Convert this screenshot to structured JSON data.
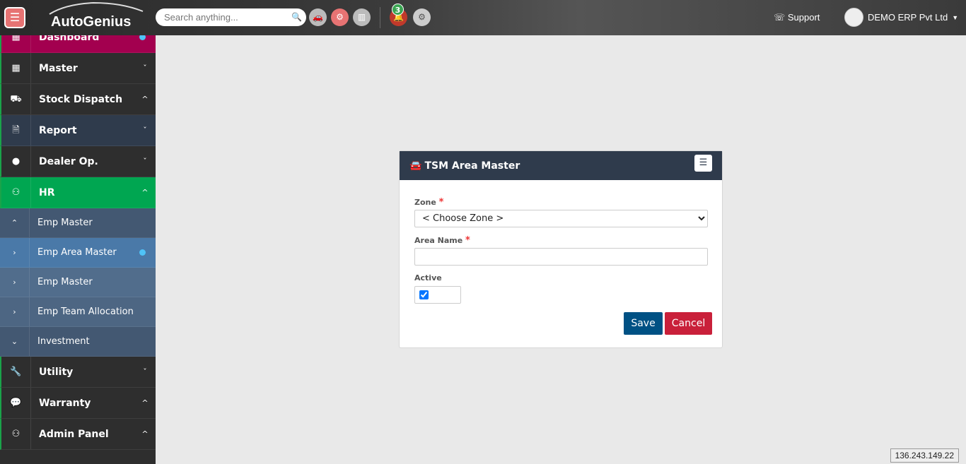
{
  "header": {
    "logo": "AutoGenius",
    "search_placeholder": "Search anything...",
    "notification_count": "3",
    "support": "Support",
    "user": "DEMO ERP Pvt Ltd"
  },
  "sidebar": {
    "items": [
      {
        "label": "Dashboard",
        "icon": "dashboard-icon",
        "bg": "#a3004f",
        "dot": true
      },
      {
        "label": "Master",
        "icon": "grid-icon",
        "chevron": "down"
      },
      {
        "label": "Stock Dispatch",
        "icon": "truck-icon",
        "chevron": "up"
      },
      {
        "label": "Report",
        "icon": "excel-file-icon",
        "bg": "#2f3b4c",
        "chevron": "down"
      },
      {
        "label": "Dealer Op.",
        "icon": "user-icon",
        "chevron": "down"
      },
      {
        "label": "HR",
        "icon": "users-icon",
        "bg": "#00a651",
        "chevron": "up"
      },
      {
        "label": "Emp Master",
        "sub": true,
        "chevron": "up",
        "bg": "#435872"
      },
      {
        "label": "Emp Area Master",
        "sub": true,
        "chevron": "right",
        "bg": "#4a79a8",
        "dot": true
      },
      {
        "label": "Emp Master",
        "sub": true,
        "chevron": "right",
        "bg": "#516d8c"
      },
      {
        "label": "Emp Team Allocation",
        "sub": true,
        "chevron": "right",
        "bg": "#4d6683"
      },
      {
        "label": "Investment",
        "sub": true,
        "chevron": "down",
        "bg": "#435872"
      },
      {
        "label": "Utility",
        "icon": "wrench-icon",
        "chevron": "down"
      },
      {
        "label": "Warranty",
        "icon": "chat-icon",
        "chevron": "up"
      },
      {
        "label": "Admin Panel",
        "icon": "users-icon",
        "chevron": "up"
      }
    ]
  },
  "form": {
    "title": "TSM Area Master",
    "zone_label": "Zone",
    "zone_value": "< Choose Zone >",
    "area_label": "Area Name",
    "area_value": "",
    "active_label": "Active",
    "active": true,
    "save": "Save",
    "cancel": "Cancel",
    "required": "*"
  },
  "footer": {
    "ip": "136.243.149.22"
  },
  "colors": {
    "save": "#005184",
    "cancel": "#c9203a",
    "header": "#2f3b4c"
  }
}
